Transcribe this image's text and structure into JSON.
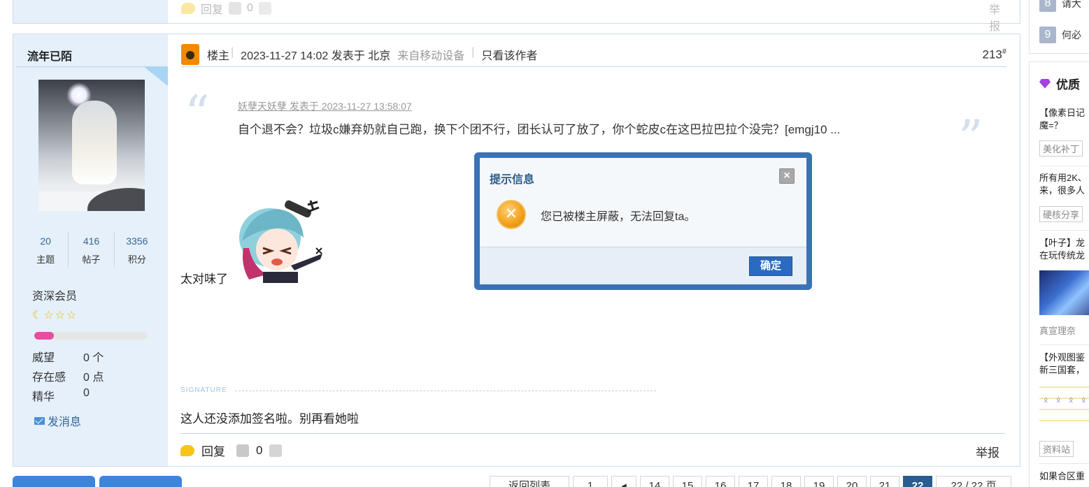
{
  "prev_post": {
    "reply_label": "回复",
    "like_count": "0",
    "report_label": "举报"
  },
  "author": {
    "name": "流年已陌",
    "stats": [
      {
        "num": "20",
        "label": "主题"
      },
      {
        "num": "416",
        "label": "帖子"
      },
      {
        "num": "3356",
        "label": "积分"
      }
    ],
    "rank_title": "资深会员",
    "exp_fraction": 0.17,
    "attrs": [
      {
        "key": "威望",
        "value": "0 个"
      },
      {
        "key": "存在感",
        "value": "0 点"
      },
      {
        "key": "精华",
        "value": "0"
      }
    ],
    "send_message": "发消息"
  },
  "post": {
    "owner_label": "楼主",
    "sep1": "|",
    "timestamp": "2023-11-27 14:02 发表于 北京",
    "device": "来自移动设备",
    "sep2": "|",
    "only_author": "只看该作者",
    "floor_number": "213",
    "floor_mark": "#",
    "quote": {
      "meta": "妖孽天妖孽 发表于 2023-11-27 13:58:07",
      "body": "自个退不会？垃圾c嫌弃奶就自己跑，换下个团不行，团长认可了放了，你个蛇皮c在这巴拉巴拉个没完？[emgj10 ..."
    },
    "reply_text": "太对味了",
    "signature_label": "SIGNATURE",
    "signature_text": "这人还没添加签名啦。别再看她啦",
    "reply_label": "回复",
    "like_count": "0",
    "report_label": "举报"
  },
  "sidebar": {
    "rank_items": [
      {
        "num": "8",
        "text": "请大"
      },
      {
        "num": "9",
        "text": "何必"
      }
    ],
    "title": "优质",
    "items": [
      {
        "line1": "【像素日记",
        "line2": "魔=？",
        "tag": "美化补丁"
      },
      {
        "line1": "所有用2K、",
        "line2": "来，很多人",
        "tag": "硬核分享"
      },
      {
        "line1": "【叶子】龙",
        "line2": "在玩传统龙",
        "tag": "真宣理奈"
      },
      {
        "line1": "【外观图鉴",
        "line2": "新三国套，",
        "tag": "资料站"
      }
    ],
    "last_item": "如果合区重"
  },
  "pager": {
    "back_label": "返回列表",
    "pages": [
      "1",
      "14",
      "15",
      "16",
      "17",
      "18",
      "19",
      "20",
      "21",
      "22"
    ],
    "current": "22",
    "input_value": "22",
    "total_label": "/ 22 页"
  },
  "modal": {
    "title": "提示信息",
    "close_glyph": "×",
    "message": "您已被楼主屏蔽，无法回复ta。",
    "ok_label": "确定"
  },
  "colors": {
    "accent": "#3a72b5",
    "side_bg": "#e5f0fb",
    "link": "#336699",
    "exp_bar": "#e64ea0"
  }
}
